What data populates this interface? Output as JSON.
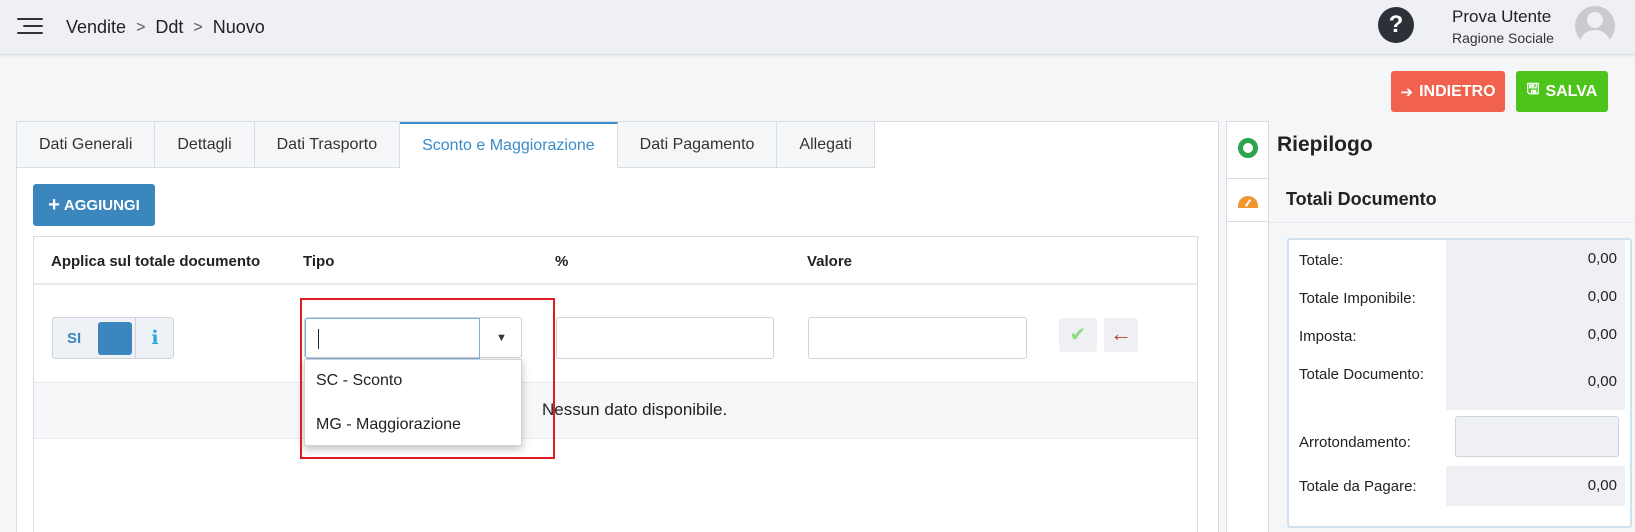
{
  "header": {
    "breadcrumb": [
      "Vendite",
      "Ddt",
      "Nuovo"
    ],
    "separator": ">",
    "help_label": "?",
    "user_name": "Prova Utente",
    "user_org": "Ragione Sociale"
  },
  "actions": {
    "back_label": "INDIETRO",
    "back_color": "#f0614e",
    "save_label": "SALVA",
    "save_color": "#4cc41b"
  },
  "tabs": [
    {
      "label": "Dati Generali",
      "active": false
    },
    {
      "label": "Dettagli",
      "active": false
    },
    {
      "label": "Dati Trasporto",
      "active": false
    },
    {
      "label": "Sconto e Maggiorazione",
      "active": true
    },
    {
      "label": "Dati Pagamento",
      "active": false
    },
    {
      "label": "Allegati",
      "active": false
    }
  ],
  "content": {
    "add_label": "AGGIUNGI",
    "columns": [
      "Applica sul totale documento",
      "Tipo",
      "%",
      "Valore"
    ],
    "toggle_label": "SI",
    "info_label": "i",
    "tipo_value": "",
    "perc_value": "",
    "valore_value": "",
    "empty_text": "Nessun dato disponibile.",
    "dropdown_options": [
      "SC - Sconto",
      "MG - Maggiorazione"
    ]
  },
  "summary": {
    "title": "Riepilogo",
    "subtitle": "Totali Documento",
    "rows": [
      {
        "label": "Totale:",
        "value": "0,00"
      },
      {
        "label": "Totale Imponibile:",
        "value": "0,00"
      },
      {
        "label": "Imposta:",
        "value": "0,00"
      },
      {
        "label": "Totale Documento:",
        "value": "0,00"
      },
      {
        "label": "Arrotondamento:",
        "value": ""
      },
      {
        "label": "Totale da Pagare:",
        "value": "0,00"
      }
    ]
  },
  "colors": {
    "accent": "#3a86bd",
    "highlight": "#e01b24"
  }
}
